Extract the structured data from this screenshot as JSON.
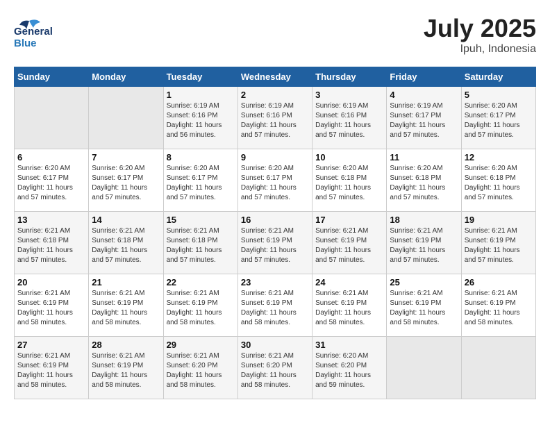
{
  "header": {
    "logo_general": "General",
    "logo_blue": "Blue",
    "month_year": "July 2025",
    "location": "Ipuh, Indonesia"
  },
  "weekdays": [
    "Sunday",
    "Monday",
    "Tuesday",
    "Wednesday",
    "Thursday",
    "Friday",
    "Saturday"
  ],
  "weeks": [
    [
      {
        "day": "",
        "empty": true
      },
      {
        "day": "",
        "empty": true
      },
      {
        "day": "1",
        "sunrise": "Sunrise: 6:19 AM",
        "sunset": "Sunset: 6:16 PM",
        "daylight": "Daylight: 11 hours and 56 minutes."
      },
      {
        "day": "2",
        "sunrise": "Sunrise: 6:19 AM",
        "sunset": "Sunset: 6:16 PM",
        "daylight": "Daylight: 11 hours and 57 minutes."
      },
      {
        "day": "3",
        "sunrise": "Sunrise: 6:19 AM",
        "sunset": "Sunset: 6:16 PM",
        "daylight": "Daylight: 11 hours and 57 minutes."
      },
      {
        "day": "4",
        "sunrise": "Sunrise: 6:19 AM",
        "sunset": "Sunset: 6:17 PM",
        "daylight": "Daylight: 11 hours and 57 minutes."
      },
      {
        "day": "5",
        "sunrise": "Sunrise: 6:20 AM",
        "sunset": "Sunset: 6:17 PM",
        "daylight": "Daylight: 11 hours and 57 minutes."
      }
    ],
    [
      {
        "day": "6",
        "sunrise": "Sunrise: 6:20 AM",
        "sunset": "Sunset: 6:17 PM",
        "daylight": "Daylight: 11 hours and 57 minutes."
      },
      {
        "day": "7",
        "sunrise": "Sunrise: 6:20 AM",
        "sunset": "Sunset: 6:17 PM",
        "daylight": "Daylight: 11 hours and 57 minutes."
      },
      {
        "day": "8",
        "sunrise": "Sunrise: 6:20 AM",
        "sunset": "Sunset: 6:17 PM",
        "daylight": "Daylight: 11 hours and 57 minutes."
      },
      {
        "day": "9",
        "sunrise": "Sunrise: 6:20 AM",
        "sunset": "Sunset: 6:17 PM",
        "daylight": "Daylight: 11 hours and 57 minutes."
      },
      {
        "day": "10",
        "sunrise": "Sunrise: 6:20 AM",
        "sunset": "Sunset: 6:18 PM",
        "daylight": "Daylight: 11 hours and 57 minutes."
      },
      {
        "day": "11",
        "sunrise": "Sunrise: 6:20 AM",
        "sunset": "Sunset: 6:18 PM",
        "daylight": "Daylight: 11 hours and 57 minutes."
      },
      {
        "day": "12",
        "sunrise": "Sunrise: 6:20 AM",
        "sunset": "Sunset: 6:18 PM",
        "daylight": "Daylight: 11 hours and 57 minutes."
      }
    ],
    [
      {
        "day": "13",
        "sunrise": "Sunrise: 6:21 AM",
        "sunset": "Sunset: 6:18 PM",
        "daylight": "Daylight: 11 hours and 57 minutes."
      },
      {
        "day": "14",
        "sunrise": "Sunrise: 6:21 AM",
        "sunset": "Sunset: 6:18 PM",
        "daylight": "Daylight: 11 hours and 57 minutes."
      },
      {
        "day": "15",
        "sunrise": "Sunrise: 6:21 AM",
        "sunset": "Sunset: 6:18 PM",
        "daylight": "Daylight: 11 hours and 57 minutes."
      },
      {
        "day": "16",
        "sunrise": "Sunrise: 6:21 AM",
        "sunset": "Sunset: 6:19 PM",
        "daylight": "Daylight: 11 hours and 57 minutes."
      },
      {
        "day": "17",
        "sunrise": "Sunrise: 6:21 AM",
        "sunset": "Sunset: 6:19 PM",
        "daylight": "Daylight: 11 hours and 57 minutes."
      },
      {
        "day": "18",
        "sunrise": "Sunrise: 6:21 AM",
        "sunset": "Sunset: 6:19 PM",
        "daylight": "Daylight: 11 hours and 57 minutes."
      },
      {
        "day": "19",
        "sunrise": "Sunrise: 6:21 AM",
        "sunset": "Sunset: 6:19 PM",
        "daylight": "Daylight: 11 hours and 57 minutes."
      }
    ],
    [
      {
        "day": "20",
        "sunrise": "Sunrise: 6:21 AM",
        "sunset": "Sunset: 6:19 PM",
        "daylight": "Daylight: 11 hours and 58 minutes."
      },
      {
        "day": "21",
        "sunrise": "Sunrise: 6:21 AM",
        "sunset": "Sunset: 6:19 PM",
        "daylight": "Daylight: 11 hours and 58 minutes."
      },
      {
        "day": "22",
        "sunrise": "Sunrise: 6:21 AM",
        "sunset": "Sunset: 6:19 PM",
        "daylight": "Daylight: 11 hours and 58 minutes."
      },
      {
        "day": "23",
        "sunrise": "Sunrise: 6:21 AM",
        "sunset": "Sunset: 6:19 PM",
        "daylight": "Daylight: 11 hours and 58 minutes."
      },
      {
        "day": "24",
        "sunrise": "Sunrise: 6:21 AM",
        "sunset": "Sunset: 6:19 PM",
        "daylight": "Daylight: 11 hours and 58 minutes."
      },
      {
        "day": "25",
        "sunrise": "Sunrise: 6:21 AM",
        "sunset": "Sunset: 6:19 PM",
        "daylight": "Daylight: 11 hours and 58 minutes."
      },
      {
        "day": "26",
        "sunrise": "Sunrise: 6:21 AM",
        "sunset": "Sunset: 6:19 PM",
        "daylight": "Daylight: 11 hours and 58 minutes."
      }
    ],
    [
      {
        "day": "27",
        "sunrise": "Sunrise: 6:21 AM",
        "sunset": "Sunset: 6:19 PM",
        "daylight": "Daylight: 11 hours and 58 minutes."
      },
      {
        "day": "28",
        "sunrise": "Sunrise: 6:21 AM",
        "sunset": "Sunset: 6:19 PM",
        "daylight": "Daylight: 11 hours and 58 minutes."
      },
      {
        "day": "29",
        "sunrise": "Sunrise: 6:21 AM",
        "sunset": "Sunset: 6:20 PM",
        "daylight": "Daylight: 11 hours and 58 minutes."
      },
      {
        "day": "30",
        "sunrise": "Sunrise: 6:21 AM",
        "sunset": "Sunset: 6:20 PM",
        "daylight": "Daylight: 11 hours and 58 minutes."
      },
      {
        "day": "31",
        "sunrise": "Sunrise: 6:20 AM",
        "sunset": "Sunset: 6:20 PM",
        "daylight": "Daylight: 11 hours and 59 minutes."
      },
      {
        "day": "",
        "empty": true
      },
      {
        "day": "",
        "empty": true
      }
    ]
  ]
}
